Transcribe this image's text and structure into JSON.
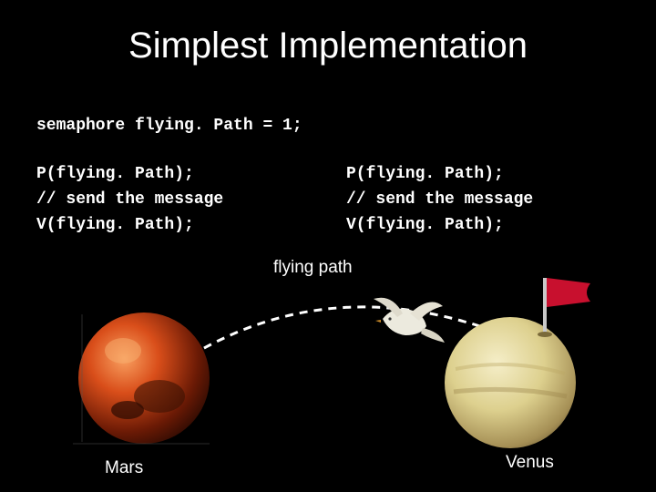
{
  "title": "Simplest Implementation",
  "declaration": "semaphore flying. Path = 1;",
  "code_left": {
    "line1": "P(flying. Path);",
    "line2": "// send the message",
    "line3": "V(flying. Path);"
  },
  "code_right": {
    "line1": "P(flying. Path);",
    "line2": "// send the message",
    "line3": "V(flying. Path);"
  },
  "labels": {
    "flying_path": "flying path",
    "mars": "Mars",
    "venus": "Venus"
  },
  "colors": {
    "flag": "#c8102e",
    "mars_body": "#8b2b0a",
    "mars_hi": "#f07030",
    "venus_body": "#d8c988",
    "venus_shadow": "#8a7a4a",
    "bird": "#e8e4da"
  }
}
